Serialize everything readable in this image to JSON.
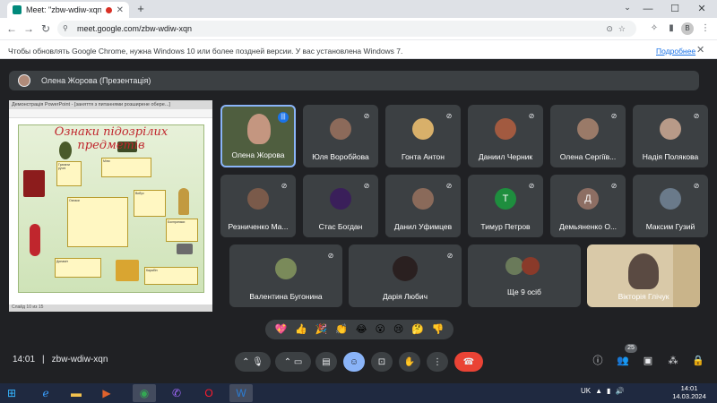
{
  "browser": {
    "tab_title": "Meet: \"zbw-wdiw-xqn\"",
    "url": "meet.google.com/zbw-wdiw-xqn",
    "profile_initial": "B",
    "minimize": "—",
    "maximize": "☐",
    "close": "✕"
  },
  "infobar": {
    "message": "Чтобы обновлять Google Chrome, нужна Windows 10 или более поздней версии. У вас установлена Windows 7.",
    "link": "Подробнее"
  },
  "presentation": {
    "presenter_label": "Олена Жорова (Презентація)",
    "slide_window_title": "Демонстрація PowerPoint - [заняття з питаннями розширене обере...]",
    "slide_title": "Ознаки підозрілих предметів",
    "status_text": "Слайд 10 из 15"
  },
  "participants": [
    {
      "name": "Олена Жорова",
      "speaking": true
    },
    {
      "name": "Юля Воробйова"
    },
    {
      "name": "Гонта Антон"
    },
    {
      "name": "Даниил Черник"
    },
    {
      "name": "Олена Сергіїв..."
    },
    {
      "name": "Надія Полякова"
    },
    {
      "name": "Резниченко Ма..."
    },
    {
      "name": "Стас Богдан"
    },
    {
      "name": "Данил Уфимцев"
    },
    {
      "name": "Тимур Петров",
      "initial": "Т"
    },
    {
      "name": "Демьяненко О...",
      "initial": "Д"
    },
    {
      "name": "Максим Гузий"
    },
    {
      "name": "Валентина Бугонина"
    },
    {
      "name": "Дарія Любич"
    },
    {
      "name": "Ще 9 осіб"
    },
    {
      "name": "Вікторія Глічук"
    }
  ],
  "meeting": {
    "time": "14:01",
    "separator": "|",
    "code": "zbw-wdiw-xqn",
    "participant_count": "25"
  },
  "colors": {
    "end_call": "#ea4335",
    "accent": "#8ab4f8",
    "tile_bg": "#3c4043",
    "bg": "#202124"
  },
  "taskbar": {
    "lang": "UK",
    "time": "14:01",
    "date": "14.03.2024"
  }
}
